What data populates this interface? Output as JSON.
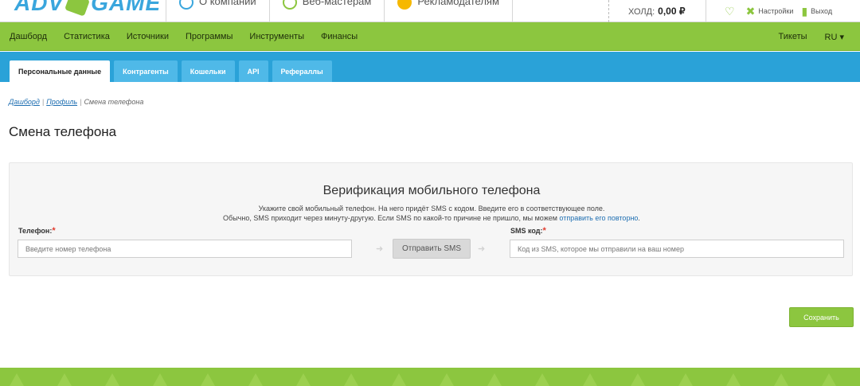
{
  "header": {
    "logo_left": "ADV",
    "logo_right": "GAME",
    "nav": [
      {
        "label": "О компании",
        "icon": "company-icon",
        "color": "#3aa6dd"
      },
      {
        "label": "Веб-мастерам",
        "icon": "webmaster-icon",
        "color": "#8cc63f"
      },
      {
        "label": "Рекламодателям",
        "icon": "advertiser-icon",
        "color": "#f6b800"
      }
    ],
    "hold_label": "ХОЛД:",
    "hold_value": "0,00 ₽",
    "settings_label": "Настройки",
    "logout_label": "Выход"
  },
  "mainnav": {
    "items": [
      "Дашборд",
      "Статистика",
      "Источники",
      "Программы",
      "Инструменты",
      "Финансы"
    ],
    "tickets": "Тикеты",
    "lang": "RU ▾"
  },
  "tabs": [
    "Персональные данные",
    "Контрагенты",
    "Кошельки",
    "API",
    "Рефераллы"
  ],
  "breadcrumb": {
    "dashboard": "Дашборд",
    "profile": "Профиль",
    "current": "Смена телефона"
  },
  "page_title": "Смена телефона",
  "panel": {
    "title": "Верификация мобильного телефона",
    "hint1": "Укажите свой мобильный телефон. На него придёт SMS с кодом. Введите его в соответствующее поле.",
    "hint2_prefix": "Обычно, SMS приходит через минуту-другую. Если SMS по какой-то причине не пришло, мы можем",
    "hint2_link": "отправить его повторно",
    "hint2_suffix": ".",
    "phone_label": "Телефон:",
    "phone_placeholder": "Введите номер телефона",
    "send_sms": "Отправить SMS",
    "sms_label": "SMS код:",
    "sms_placeholder": "Код из SMS, которое мы отправили на ваш номер"
  },
  "save_label": "Сохранить",
  "colors": {
    "green": "#8cc63f",
    "blue": "#2aa2d8",
    "link": "#1f6fb2",
    "required": "#e23b2e"
  }
}
